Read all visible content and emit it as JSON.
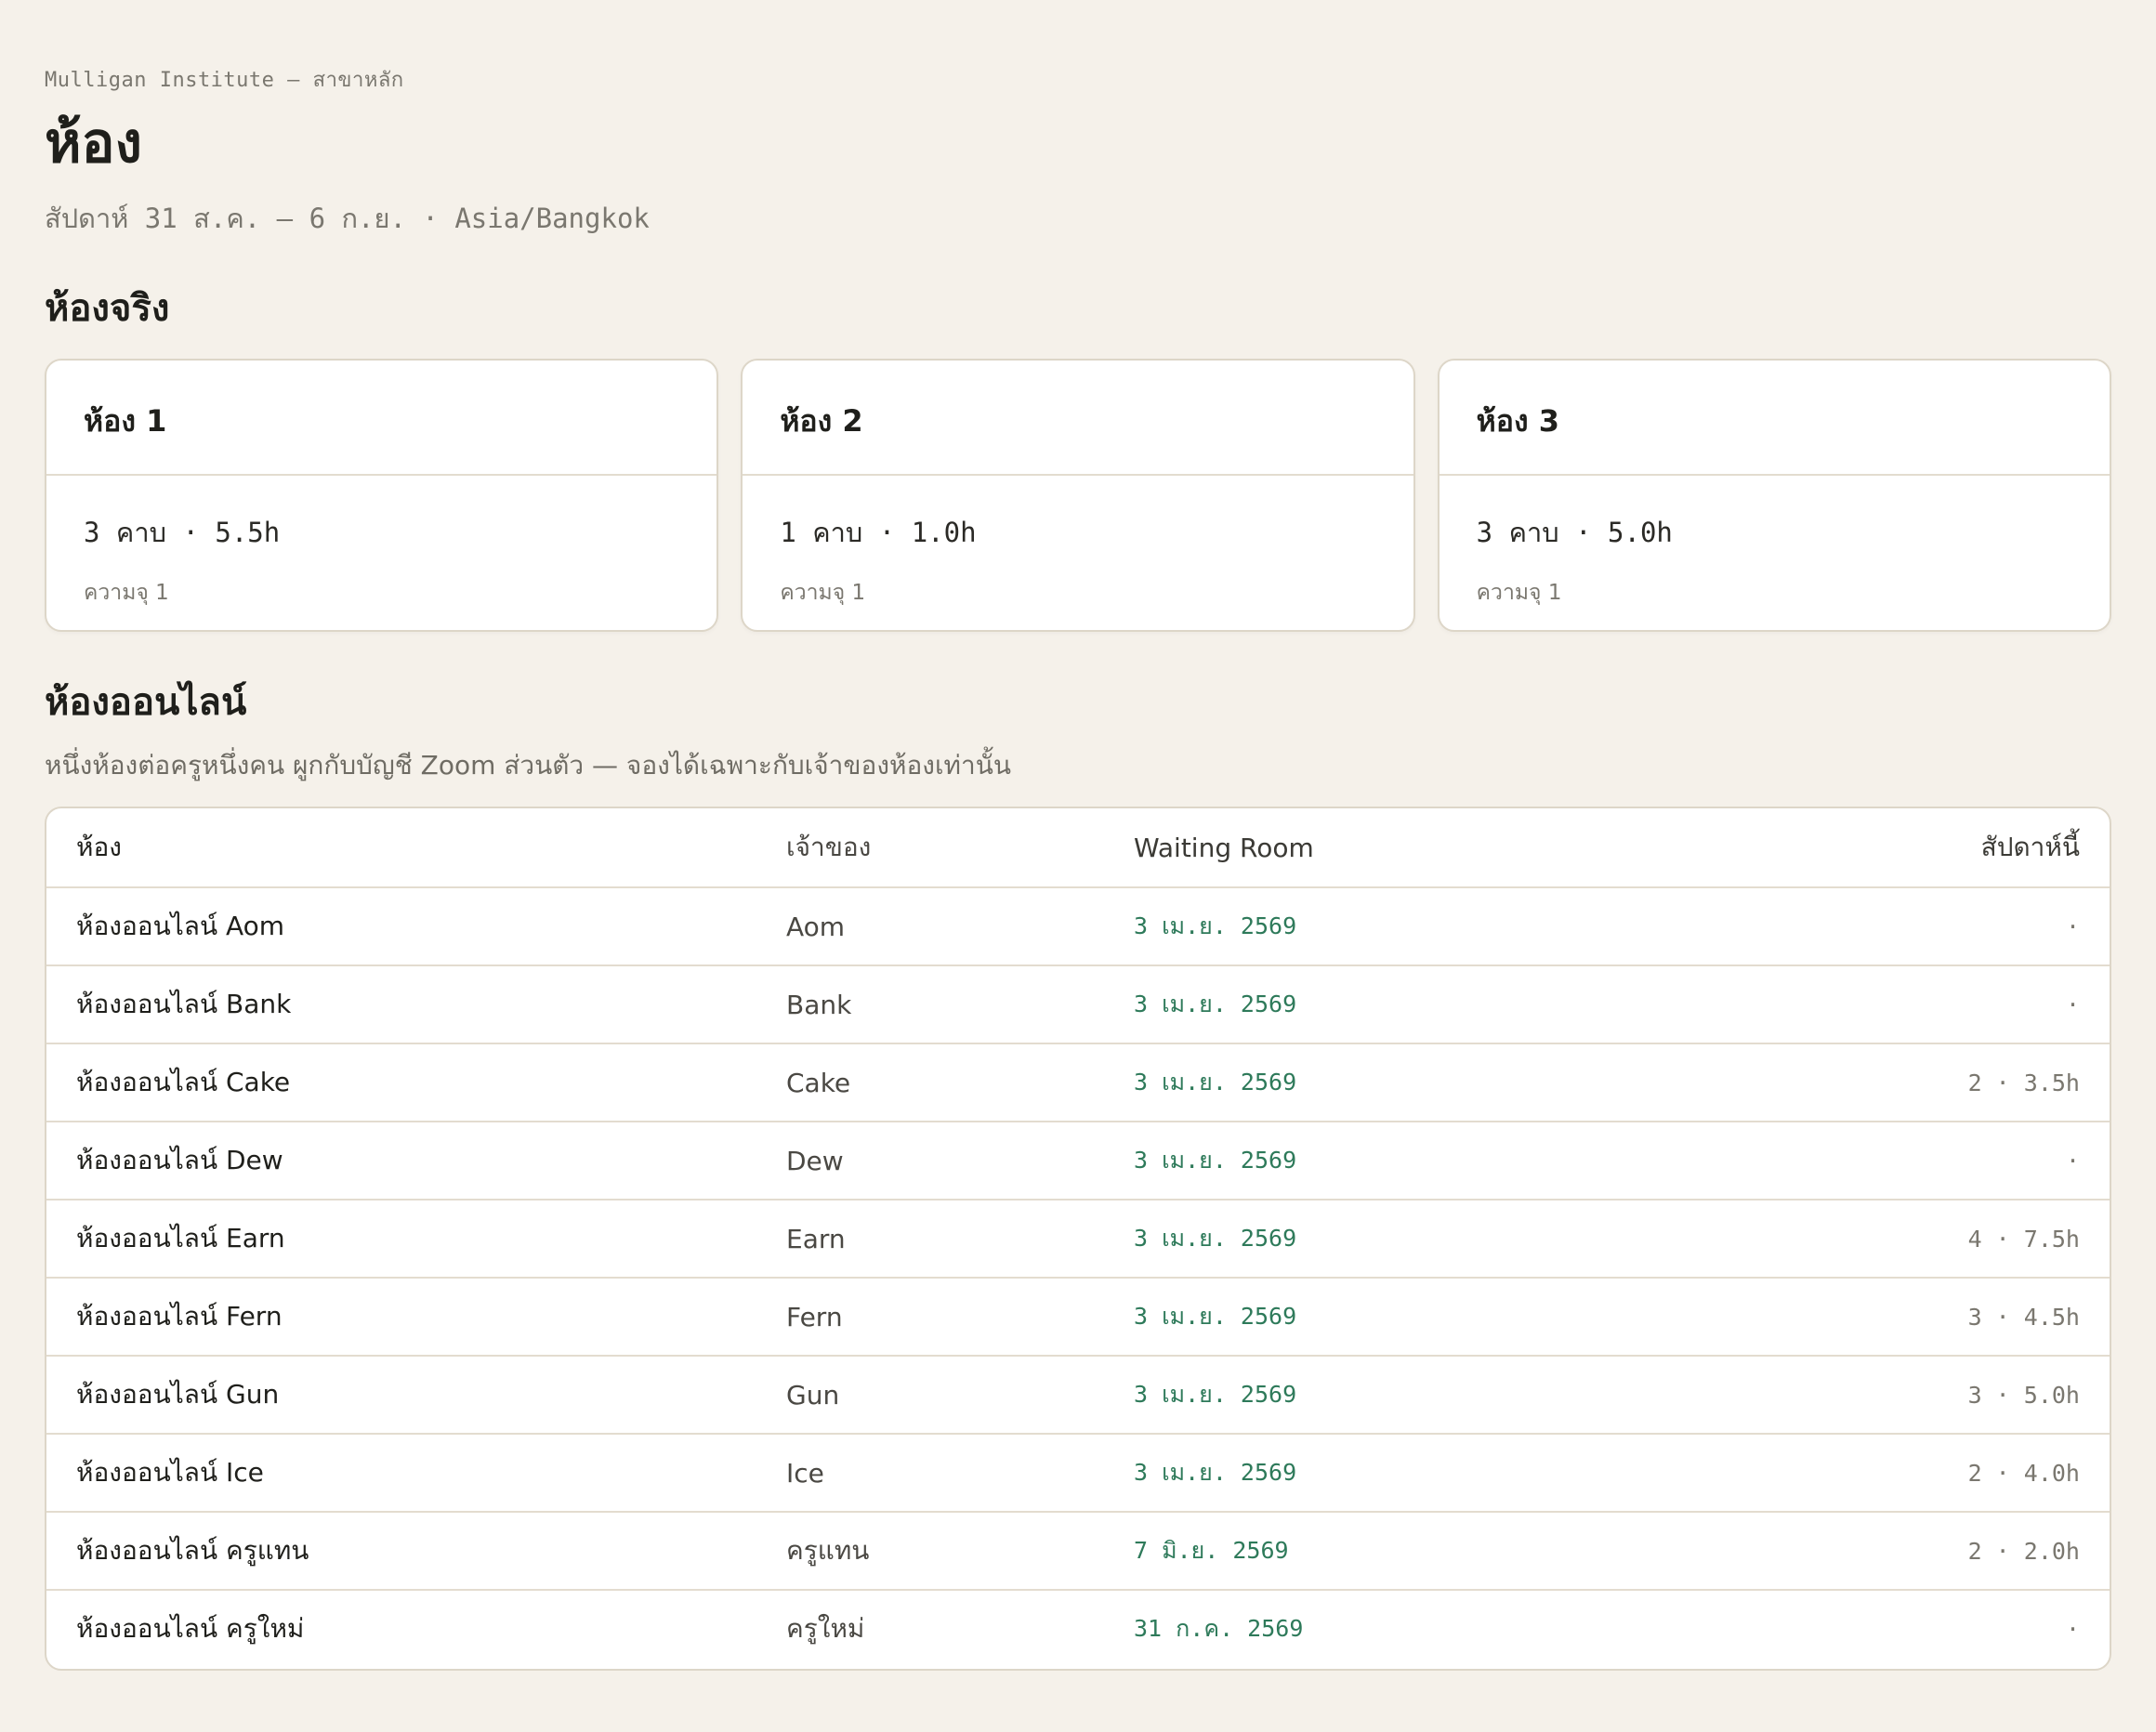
{
  "header": {
    "org": "Mulligan Institute — สาขาหลัก",
    "title": "ห้อง",
    "week": "สัปดาห์ 31 ส.ค. – 6 ก.ย. · Asia/Bangkok"
  },
  "physical": {
    "title": "ห้องจริง",
    "rooms": [
      {
        "name": "ห้อง 1",
        "stats": "3 คาบ · 5.5h",
        "capacity": "ความจุ 1"
      },
      {
        "name": "ห้อง 2",
        "stats": "1 คาบ · 1.0h",
        "capacity": "ความจุ 1"
      },
      {
        "name": "ห้อง 3",
        "stats": "3 คาบ · 5.0h",
        "capacity": "ความจุ 1"
      }
    ]
  },
  "online": {
    "title": "ห้องออนไลน์",
    "description": "หนึ่งห้องต่อครูหนึ่งคน ผูกกับบัญชี Zoom ส่วนตัว — จองได้เฉพาะกับเจ้าของห้องเท่านั้น",
    "columns": [
      "ห้อง",
      "เจ้าของ",
      "Waiting Room",
      "สัปดาห์นี้"
    ],
    "rows": [
      {
        "room": "ห้องออนไลน์ Aom",
        "owner": "Aom",
        "waiting": "3 เม.ย. 2569",
        "week": "·"
      },
      {
        "room": "ห้องออนไลน์ Bank",
        "owner": "Bank",
        "waiting": "3 เม.ย. 2569",
        "week": "·"
      },
      {
        "room": "ห้องออนไลน์ Cake",
        "owner": "Cake",
        "waiting": "3 เม.ย. 2569",
        "week": "2 · 3.5h"
      },
      {
        "room": "ห้องออนไลน์ Dew",
        "owner": "Dew",
        "waiting": "3 เม.ย. 2569",
        "week": "·"
      },
      {
        "room": "ห้องออนไลน์ Earn",
        "owner": "Earn",
        "waiting": "3 เม.ย. 2569",
        "week": "4 · 7.5h"
      },
      {
        "room": "ห้องออนไลน์ Fern",
        "owner": "Fern",
        "waiting": "3 เม.ย. 2569",
        "week": "3 · 4.5h"
      },
      {
        "room": "ห้องออนไลน์ Gun",
        "owner": "Gun",
        "waiting": "3 เม.ย. 2569",
        "week": "3 · 5.0h"
      },
      {
        "room": "ห้องออนไลน์ Ice",
        "owner": "Ice",
        "waiting": "3 เม.ย. 2569",
        "week": "2 · 4.0h"
      },
      {
        "room": "ห้องออนไลน์ ครูแทน",
        "owner": "ครูแทน",
        "waiting": "7 มิ.ย. 2569",
        "week": "2 · 2.0h"
      },
      {
        "room": "ห้องออนไลน์ ครูใหม่",
        "owner": "ครูใหม่",
        "waiting": "31 ก.ค. 2569",
        "week": "·"
      }
    ]
  }
}
